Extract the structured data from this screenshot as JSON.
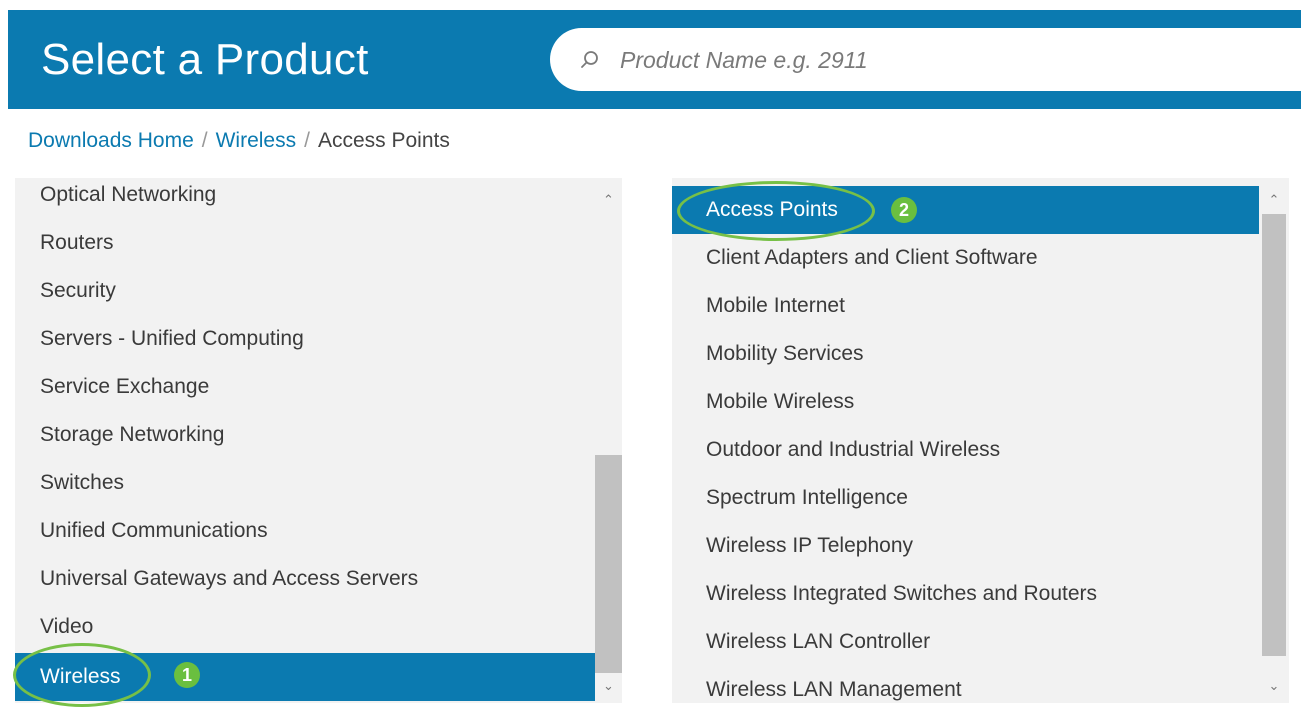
{
  "header": {
    "title": "Select a Product",
    "search_placeholder": "Product Name e.g. 2911"
  },
  "breadcrumb": {
    "items": [
      {
        "label": "Downloads Home"
      },
      {
        "label": "Wireless"
      },
      {
        "label": "Access Points"
      }
    ],
    "separator": "/"
  },
  "categories": {
    "items": [
      "Optical Networking",
      "Routers",
      "Security",
      "Servers - Unified Computing",
      "Service Exchange",
      "Storage Networking",
      "Switches",
      "Unified Communications",
      "Universal Gateways and Access Servers",
      "Video",
      "Wireless"
    ],
    "selected": "Wireless"
  },
  "subcategories": {
    "items": [
      "Access Points",
      "Client Adapters and Client Software",
      "Mobile Internet",
      "Mobility Services",
      "Mobile Wireless",
      "Outdoor and Industrial Wireless",
      "Spectrum Intelligence",
      "Wireless IP Telephony",
      "Wireless Integrated Switches and Routers",
      "Wireless LAN Controller",
      "Wireless LAN Management"
    ],
    "selected": "Access Points"
  },
  "step_badges": {
    "step1": "1",
    "step2": "2"
  },
  "colors": {
    "brand": "#0b7ab0",
    "highlight": "#77c047",
    "badge": "#6abf3f"
  }
}
